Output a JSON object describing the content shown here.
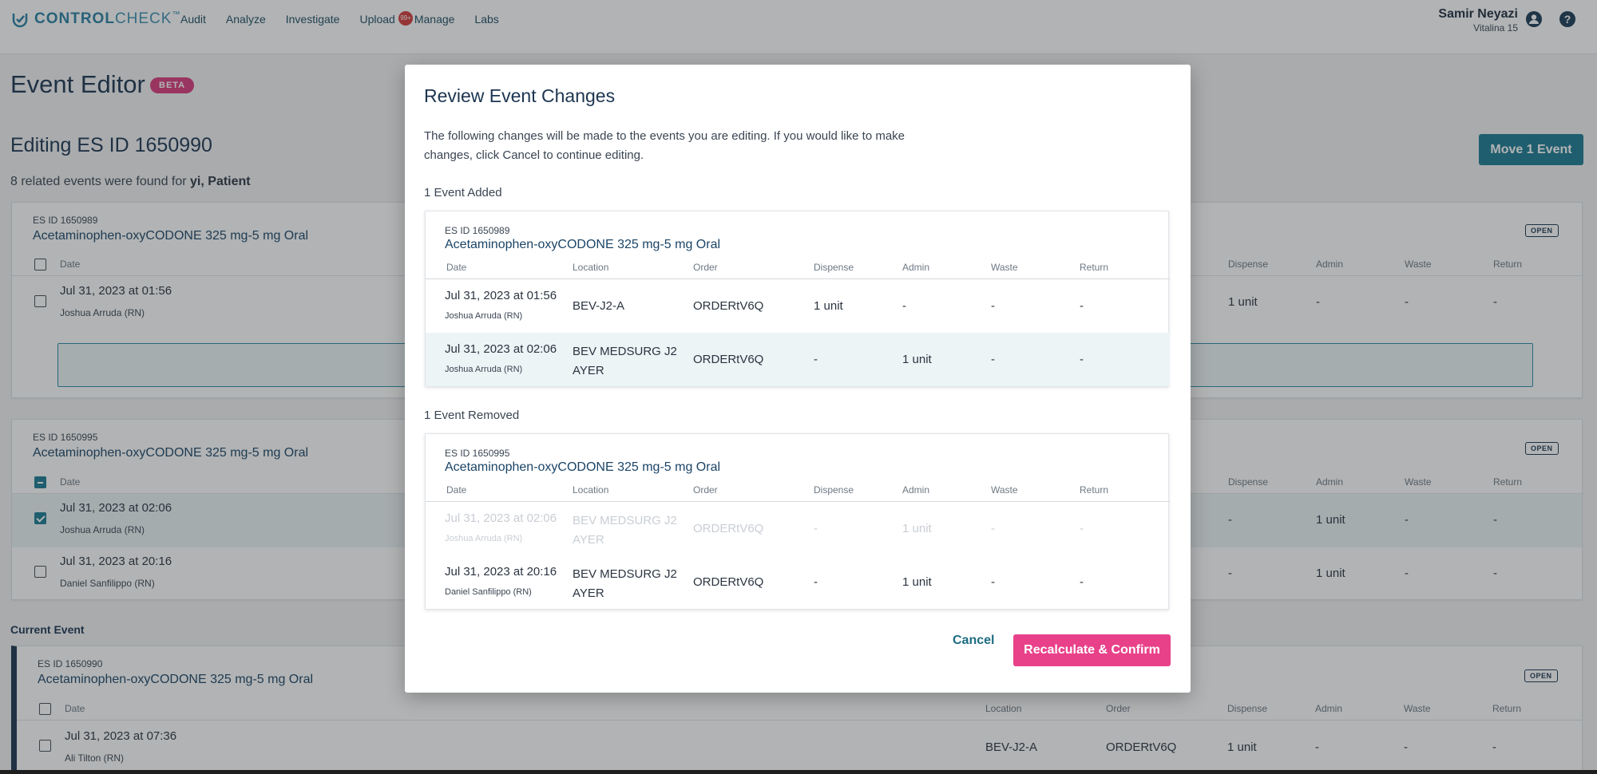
{
  "nav": {
    "brand_bold": "CONTROL",
    "brand_light": "CHECK",
    "brand_tm": "™",
    "links": [
      "Audit",
      "Analyze",
      "Investigate",
      "Upload",
      "Manage",
      "Labs"
    ],
    "upload_badge": "99+",
    "user_name": "Samir Neyazi",
    "user_site": "Vitalina 15",
    "help_glyph": "?"
  },
  "page": {
    "title": "Event Editor",
    "beta": "BETA",
    "editing_title": "Editing ES ID 1650990",
    "related_prefix": "8 related events were found for ",
    "related_patient": "yi, Patient",
    "move_button": "Move 1 Event",
    "current_event_label": "Current Event"
  },
  "columns": {
    "date": "Date",
    "location": "Location",
    "order": "Order",
    "dispense": "Dispense",
    "admin": "Admin",
    "waste": "Waste",
    "return": "Return"
  },
  "cards": [
    {
      "es_id": "ES ID 1650989",
      "drug": "Acetaminophen-oxyCODONE 325 mg-5 mg Oral",
      "status": "OPEN",
      "rows": [
        {
          "date": "Jul 31, 2023 at 01:56",
          "person": "Joshua Arruda (RN)",
          "dispense": "1 unit",
          "admin": "-",
          "waste": "-",
          "return": "-"
        }
      ]
    },
    {
      "es_id": "ES ID 1650995",
      "drug": "Acetaminophen-oxyCODONE 325 mg-5 mg Oral",
      "status": "OPEN",
      "rows": [
        {
          "date": "Jul 31, 2023 at 02:06",
          "person": "Joshua Arruda (RN)",
          "dispense": "-",
          "admin": "1 unit",
          "waste": "-",
          "return": "-"
        },
        {
          "date": "Jul 31, 2023 at 20:16",
          "person": "Daniel Sanfilippo (RN)",
          "dispense": "-",
          "admin": "1 unit",
          "waste": "-",
          "return": "-"
        }
      ]
    },
    {
      "es_id": "ES ID 1650990",
      "drug": "Acetaminophen-oxyCODONE 325 mg-5 mg Oral",
      "status": "OPEN",
      "rows": [
        {
          "date": "Jul 31, 2023 at 07:36",
          "person": "Ali Tilton (RN)",
          "location": "BEV-J2-A",
          "order": "ORDERtV6Q",
          "dispense": "1 unit",
          "admin": "-",
          "waste": "-",
          "return": "-"
        }
      ]
    }
  ],
  "modal": {
    "title": "Review Event Changes",
    "description": "The following changes will be made to the events you are editing. If you would like to make changes, click Cancel to continue editing.",
    "added_label": "1 Event Added",
    "removed_label": "1 Event Removed",
    "added": {
      "es_id": "ES ID 1650989",
      "drug": "Acetaminophen-oxyCODONE 325 mg-5 mg Oral",
      "rows": [
        {
          "date": "Jul 31, 2023 at 01:56",
          "person": "Joshua Arruda (RN)",
          "location": "BEV-J2-A",
          "order": "ORDERtV6Q",
          "dispense": "1 unit",
          "admin": "-",
          "waste": "-",
          "return": "-"
        },
        {
          "date": "Jul 31, 2023 at 02:06",
          "person": "Joshua Arruda (RN)",
          "location": "BEV MEDSURG J2 AYER",
          "order": "ORDERtV6Q",
          "dispense": "-",
          "admin": "1 unit",
          "waste": "-",
          "return": "-"
        }
      ]
    },
    "removed": {
      "es_id": "ES ID 1650995",
      "drug": "Acetaminophen-oxyCODONE 325 mg-5 mg Oral",
      "rows": [
        {
          "date": "Jul 31, 2023 at 02:06",
          "person": "Joshua Arruda (RN)",
          "location": "BEV MEDSURG J2 AYER",
          "order": "ORDERtV6Q",
          "dispense": "-",
          "admin": "1 unit",
          "waste": "-",
          "return": "-"
        },
        {
          "date": "Jul 31, 2023 at 20:16",
          "person": "Daniel Sanfilippo (RN)",
          "location": "BEV MEDSURG J2 AYER",
          "order": "ORDERtV6Q",
          "dispense": "-",
          "admin": "1 unit",
          "waste": "-",
          "return": "-"
        }
      ]
    },
    "cancel": "Cancel",
    "confirm": "Recalculate & Confirm"
  }
}
